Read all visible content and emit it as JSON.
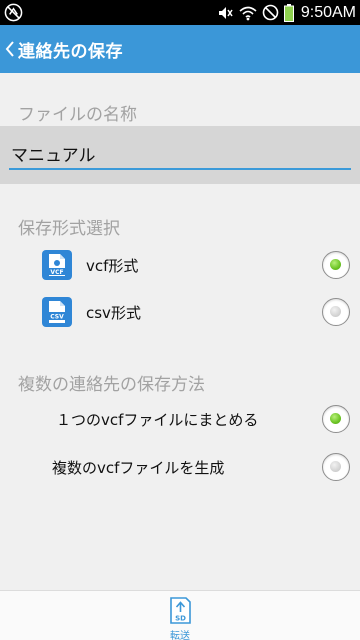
{
  "status_bar": {
    "time": "9:50AM",
    "icons": [
      "usb-debug-icon",
      "mute-icon",
      "wifi-icon",
      "do-not-disturb-icon",
      "battery-icon"
    ]
  },
  "action_bar": {
    "back_icon": "chevron-left-icon",
    "title": "連絡先の保存"
  },
  "file_name_section": {
    "header": "ファイルの名称",
    "input_value": "マニュアル"
  },
  "format_section": {
    "header": "保存形式選択",
    "options": [
      {
        "label": "vcf形式",
        "icon": "vcf-file-icon",
        "icon_text": "VCF",
        "selected": true
      },
      {
        "label": "csv形式",
        "icon": "csv-file-icon",
        "icon_text": "CSV",
        "selected": false
      }
    ]
  },
  "multi_section": {
    "header": "複数の連絡先の保存方法",
    "options": [
      {
        "label": "１つのvcfファイルにまとめる",
        "selected": true
      },
      {
        "label": "複数のvcfファイルを生成",
        "selected": false
      }
    ]
  },
  "bottom_bar": {
    "transfer_icon": "sd-upload-icon",
    "transfer_icon_text": "SD",
    "transfer_label": "転送"
  },
  "colors": {
    "accent": "#3b97d8",
    "radio_selected": "#6cc424",
    "section_header": "#a2a2a2"
  }
}
